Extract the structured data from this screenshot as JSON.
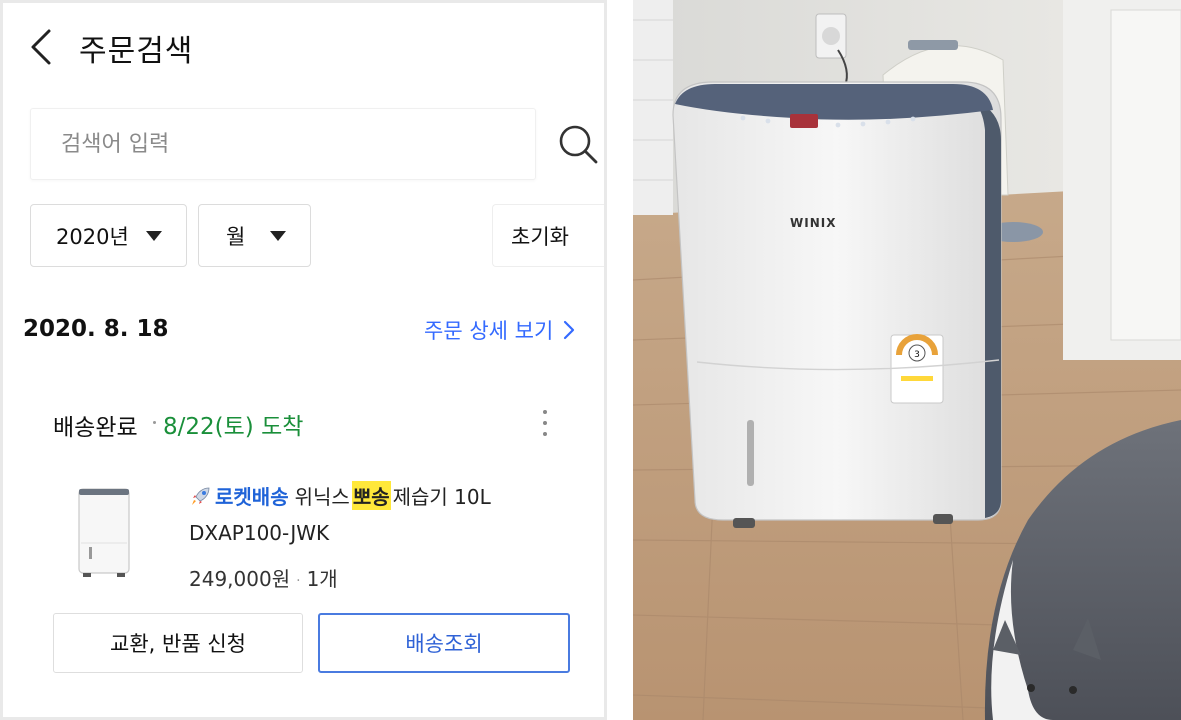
{
  "header": {
    "back_icon": "chevron-left-icon",
    "title": "주문검색"
  },
  "search": {
    "placeholder": "검색어 입력",
    "value": "",
    "icon": "search-icon"
  },
  "filters": {
    "year": "2020년",
    "month": "월",
    "reset_label": "초기화"
  },
  "order": {
    "date": "2020. 8. 18",
    "detail_link": "주문 상세 보기",
    "status": "배송완료",
    "arrival": "8/22(토) 도착",
    "more_icon": "more-vertical-icon",
    "product": {
      "badge": "로켓배송",
      "name_prefix": "위닉스",
      "name_highlight": "뽀송",
      "name_suffix": "제습기 10L",
      "model": "DXAP100-JWK",
      "price": "249,000원",
      "quantity": "1개"
    },
    "buttons": {
      "exchange": "교환, 반품 신청",
      "track": "배송조회"
    }
  },
  "photo": {
    "brand": "WINIX",
    "energy_grade": "3"
  },
  "colors": {
    "link_blue": "#346aff",
    "rocket_blue": "#1f63d8",
    "arrival_green": "#1a8f3a",
    "highlight_yellow": "#ffe83a",
    "track_border": "#4a7be0"
  }
}
